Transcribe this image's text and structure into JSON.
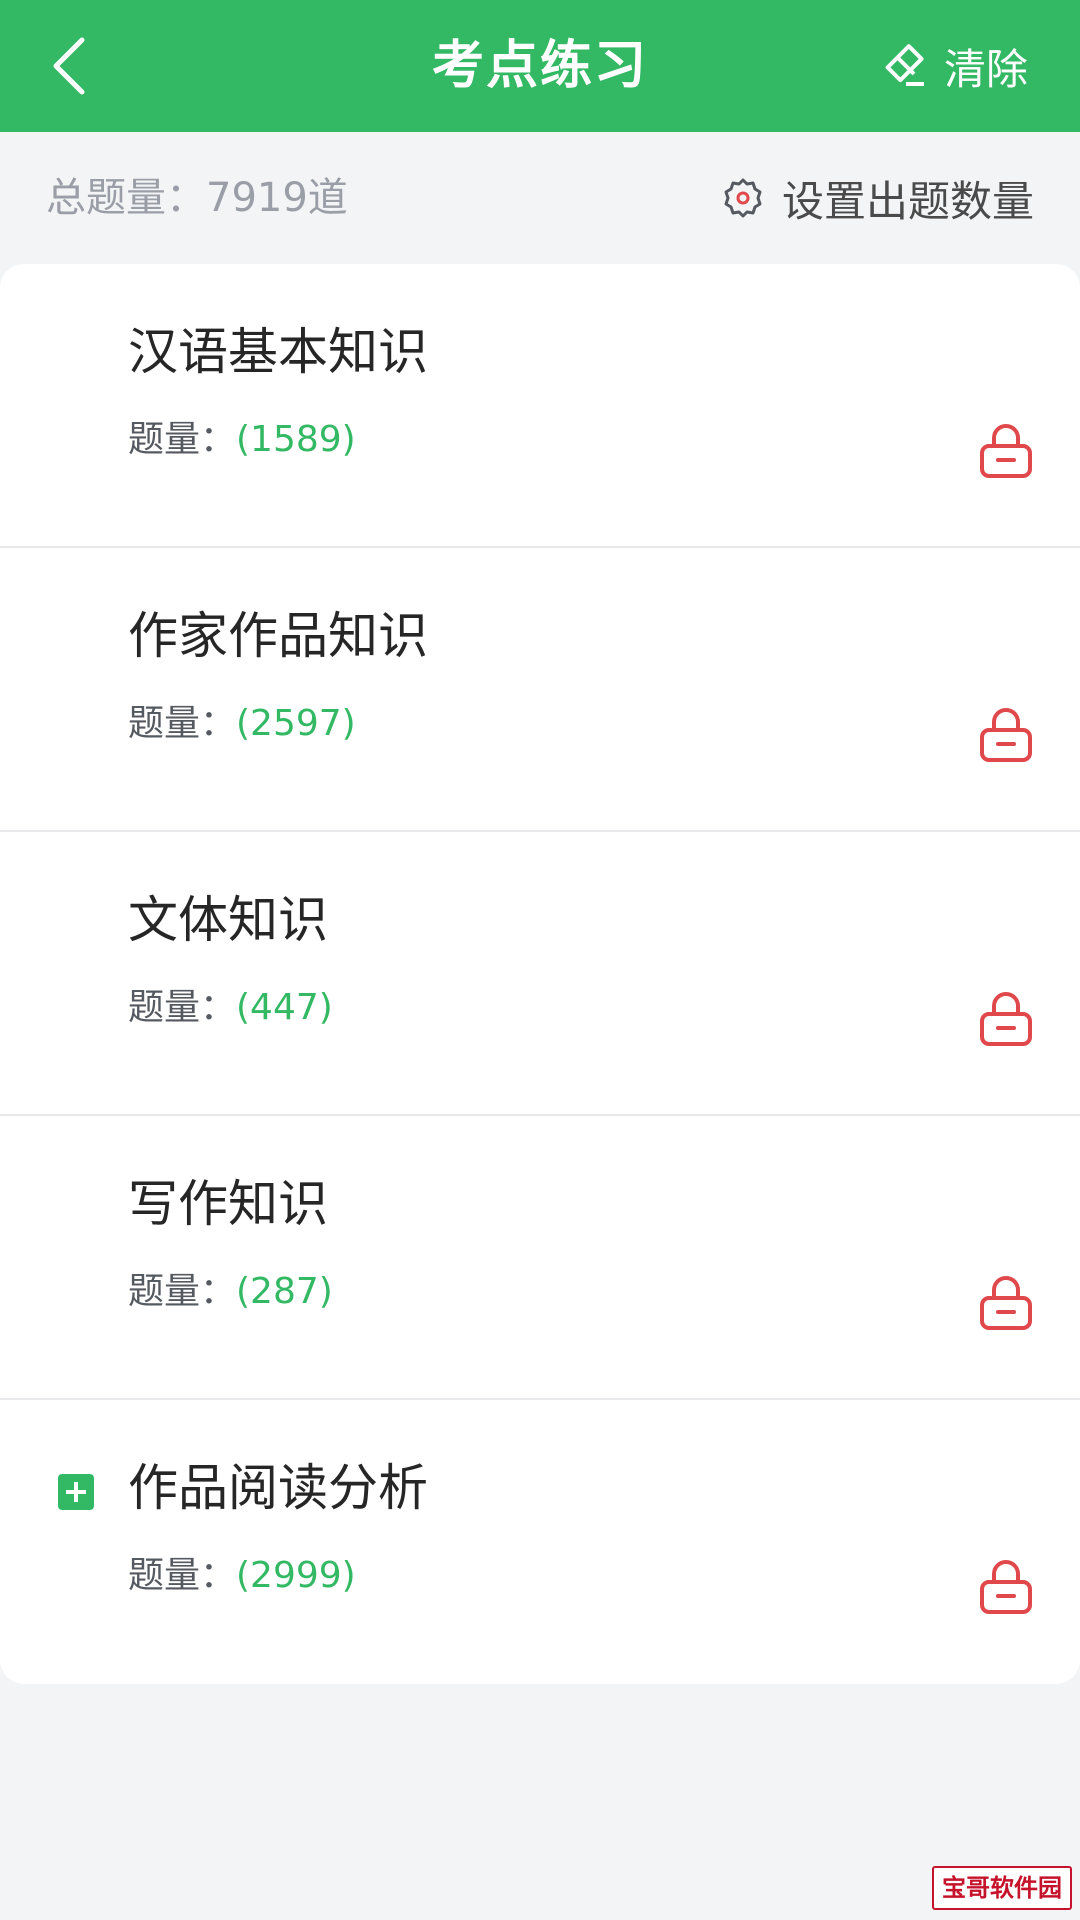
{
  "header": {
    "title": "考点练习",
    "clear_label": "清除"
  },
  "summary": {
    "total_label": "总题量：7919道",
    "settings_label": "设置出题数量"
  },
  "items": [
    {
      "title": "汉语基本知识",
      "count_label": "题量：",
      "count": "(1589)",
      "locked": true
    },
    {
      "title": "作家作品知识",
      "count_label": "题量：",
      "count": "(2597)",
      "locked": true
    },
    {
      "title": "文体知识",
      "count_label": "题量：",
      "count": "(447)",
      "locked": true
    },
    {
      "title": "写作知识",
      "count_label": "题量：",
      "count": "(287)",
      "locked": true
    },
    {
      "title": "作品阅读分析",
      "count_label": "题量：",
      "count": "(2999)",
      "locked": true,
      "expandable": true
    }
  ],
  "colors": {
    "accent": "#33b864",
    "lock": "#e0484c",
    "background": "#f3f4f6"
  },
  "icons": {
    "back": "chevron-left-icon",
    "clear": "eraser-icon",
    "settings": "gear-icon",
    "lock": "lock-icon",
    "expand": "plus-square-icon"
  },
  "watermark": "宝哥软件园"
}
